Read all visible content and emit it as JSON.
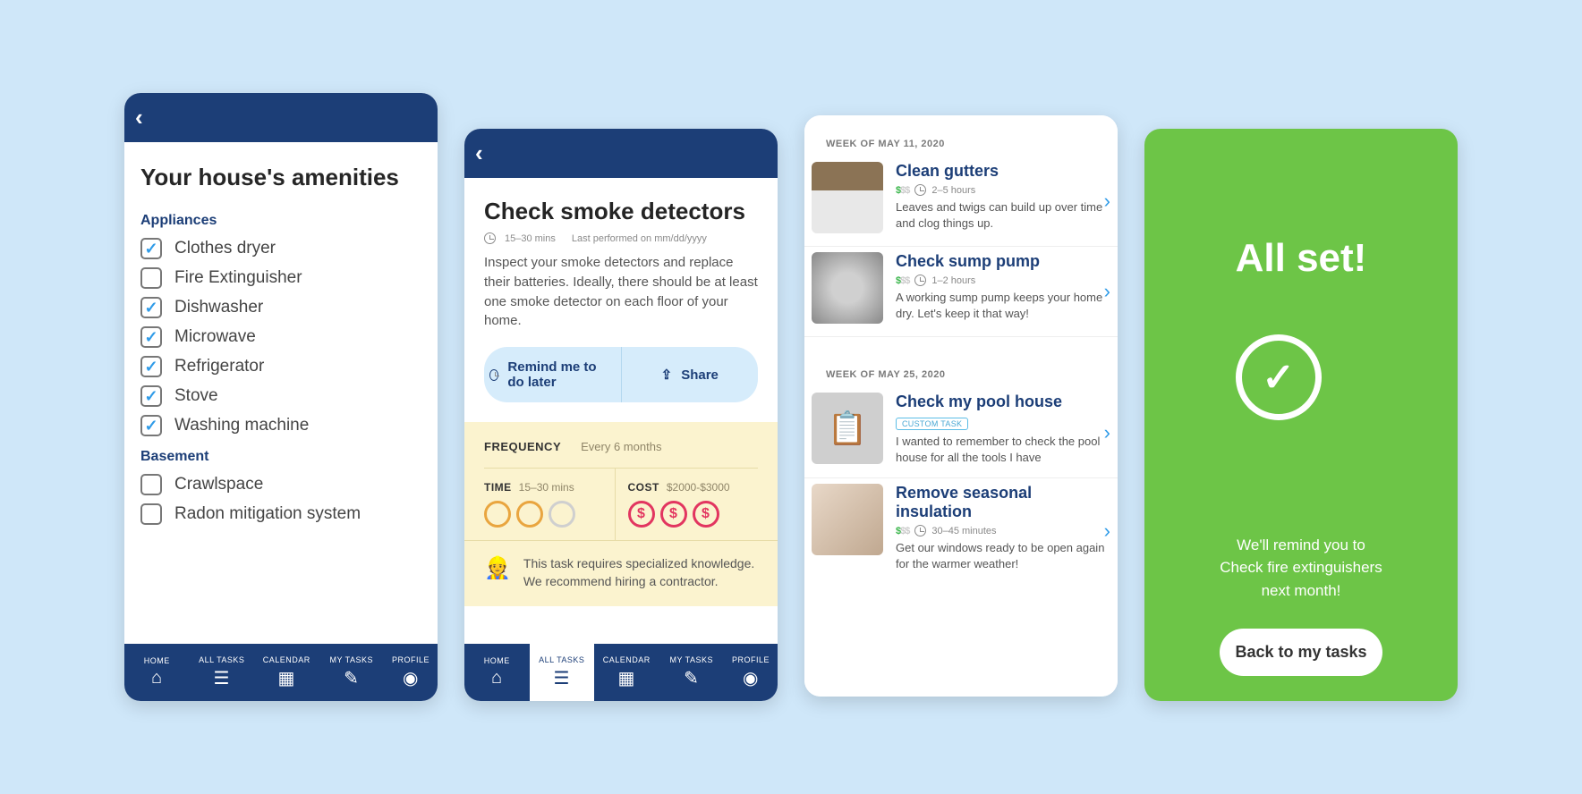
{
  "screen1": {
    "title": "Your house's amenities",
    "sections": [
      {
        "heading": "Appliances",
        "items": [
          {
            "label": "Clothes dryer",
            "checked": true
          },
          {
            "label": "Fire Extinguisher",
            "checked": false
          },
          {
            "label": "Dishwasher",
            "checked": true
          },
          {
            "label": "Microwave",
            "checked": true
          },
          {
            "label": "Refrigerator",
            "checked": true
          },
          {
            "label": "Stove",
            "checked": true
          },
          {
            "label": "Washing machine",
            "checked": true
          }
        ]
      },
      {
        "heading": "Basement",
        "items": [
          {
            "label": "Crawlspace",
            "checked": false
          },
          {
            "label": "Radon mitigation system",
            "checked": false
          }
        ]
      }
    ],
    "nav": {
      "items": [
        {
          "label": "HOME",
          "active": false
        },
        {
          "label": "ALL TASKS",
          "active": false
        },
        {
          "label": "CALENDAR",
          "active": false
        },
        {
          "label": "MY TASKS",
          "active": false
        },
        {
          "label": "PROFILE",
          "active": false
        }
      ]
    }
  },
  "screen2": {
    "title": "Check smoke detectors",
    "duration": "15–30 mins",
    "last_performed": "Last performed on mm/dd/yyyy",
    "description": "Inspect your smoke detectors and replace their batteries. Ideally, there should be at least one smoke detector on each floor of your home.",
    "remind_label": "Remind me to do later",
    "share_label": "Share",
    "frequency_label": "FREQUENCY",
    "frequency_value": "Every 6 months",
    "time_label": "TIME",
    "time_value": "15–30 mins",
    "cost_label": "COST",
    "cost_value": "$2000-$3000",
    "advice": "This task requires specialized knowledge. We recommend hiring a contractor.",
    "nav": {
      "items": [
        {
          "label": "HOME",
          "active": false
        },
        {
          "label": "ALL TASKS",
          "active": true
        },
        {
          "label": "CALENDAR",
          "active": false
        },
        {
          "label": "MY TASKS",
          "active": false
        },
        {
          "label": "PROFILE",
          "active": false
        }
      ]
    }
  },
  "screen3": {
    "weeks": [
      {
        "label": "WEEK OF MAY 11, 2020",
        "tasks": [
          {
            "title": "Clean gutters",
            "cost_level": 1,
            "time": "2–5 hours",
            "desc": "Leaves and twigs can build up over time and clog things up.",
            "thumb": "gutters"
          },
          {
            "title": "Check sump pump",
            "cost_level": 1,
            "time": "1–2 hours",
            "desc": "A working sump pump keeps your home dry. Let's keep it that way!",
            "thumb": "sump"
          }
        ]
      },
      {
        "label": "WEEK OF MAY 25, 2020",
        "tasks": [
          {
            "title": "Check my pool house",
            "custom": true,
            "custom_label": "CUSTOM TASK",
            "desc": "I wanted to remember to check the pool house for all the tools I have",
            "thumb": "pool"
          },
          {
            "title": "Remove seasonal insulation",
            "cost_level": 1,
            "time": "30–45 minutes",
            "desc": "Get our windows ready to be open again for the warmer weather!",
            "thumb": "insul"
          }
        ]
      }
    ]
  },
  "screen4": {
    "title": "All set!",
    "message_line1": "We'll remind you to",
    "message_line2": "Check fire extinguishers",
    "message_line3": "next month!",
    "button": "Back to my tasks"
  }
}
